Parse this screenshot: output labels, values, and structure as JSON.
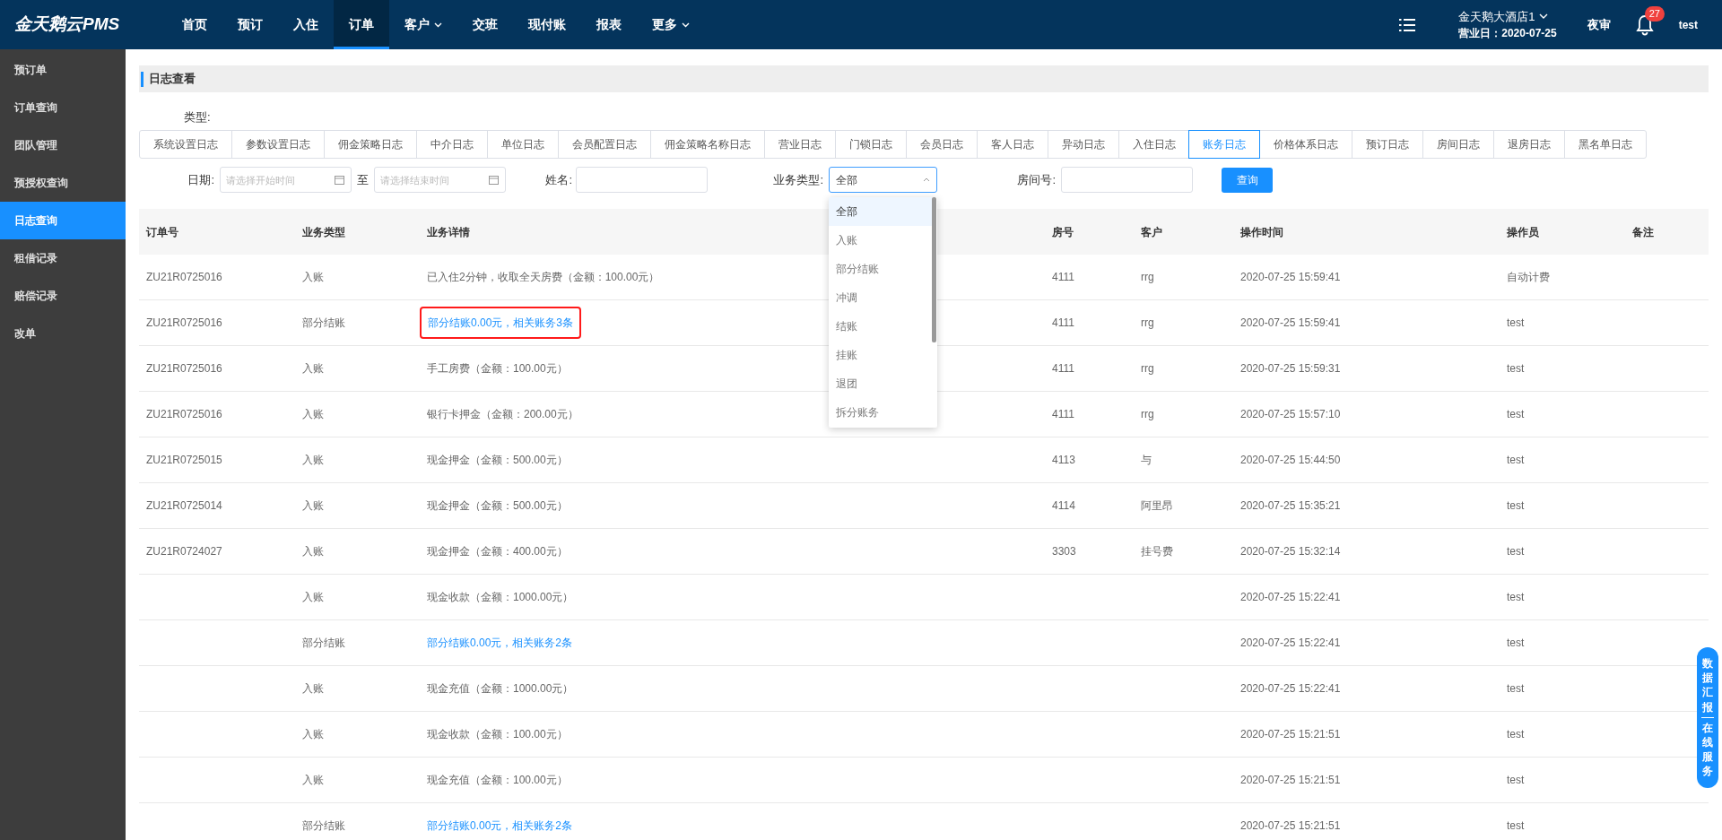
{
  "brand": "金天鹅云PMS",
  "nav": [
    {
      "label": "首页",
      "selected": false,
      "caret": false
    },
    {
      "label": "预订",
      "selected": false,
      "caret": false
    },
    {
      "label": "入住",
      "selected": false,
      "caret": false
    },
    {
      "label": "订单",
      "selected": true,
      "caret": false
    },
    {
      "label": "客户",
      "selected": false,
      "caret": true
    },
    {
      "label": "交班",
      "selected": false,
      "caret": false
    },
    {
      "label": "现付账",
      "selected": false,
      "caret": false
    },
    {
      "label": "报表",
      "selected": false,
      "caret": false
    },
    {
      "label": "更多",
      "selected": false,
      "caret": true
    }
  ],
  "header_right": {
    "hotel": "金天鹅大酒店1",
    "business_day": "营业日：2020-07-25",
    "night_audit": "夜审",
    "notification_count": "27",
    "user": "test"
  },
  "sidebar": {
    "items": [
      {
        "label": "预订单",
        "selected": false
      },
      {
        "label": "订单查询",
        "selected": false
      },
      {
        "label": "团队管理",
        "selected": false
      },
      {
        "label": "预授权查询",
        "selected": false
      },
      {
        "label": "日志查询",
        "selected": true
      },
      {
        "label": "租借记录",
        "selected": false
      },
      {
        "label": "赔偿记录",
        "selected": false
      },
      {
        "label": "改单",
        "selected": false
      }
    ]
  },
  "page_title": "日志查看",
  "type_label": "类型:",
  "log_types": [
    {
      "label": "系统设置日志",
      "selected": false
    },
    {
      "label": "参数设置日志",
      "selected": false
    },
    {
      "label": "佣金策略日志",
      "selected": false
    },
    {
      "label": "中介日志",
      "selected": false
    },
    {
      "label": "单位日志",
      "selected": false
    },
    {
      "label": "会员配置日志",
      "selected": false
    },
    {
      "label": "佣金策略名称日志",
      "selected": false
    },
    {
      "label": "营业日志",
      "selected": false
    },
    {
      "label": "门锁日志",
      "selected": false
    },
    {
      "label": "会员日志",
      "selected": false
    },
    {
      "label": "客人日志",
      "selected": false
    },
    {
      "label": "异动日志",
      "selected": false
    },
    {
      "label": "入住日志",
      "selected": false
    },
    {
      "label": "账务日志",
      "selected": true
    },
    {
      "label": "价格体系日志",
      "selected": false
    },
    {
      "label": "预订日志",
      "selected": false
    },
    {
      "label": "房间日志",
      "selected": false
    },
    {
      "label": "退房日志",
      "selected": false
    },
    {
      "label": "黑名单日志",
      "selected": false
    }
  ],
  "filters": {
    "date_label": "日期:",
    "start_placeholder": "请选择开始时间",
    "to": "至",
    "end_placeholder": "请选择结束时间",
    "name_label": "姓名:",
    "business_type_label": "业务类型:",
    "business_type_value": "全部",
    "room_label": "房间号:",
    "query_button": "查询",
    "business_type_options": [
      {
        "label": "全部",
        "selected": true
      },
      {
        "label": "入账",
        "selected": false
      },
      {
        "label": "部分结账",
        "selected": false
      },
      {
        "label": "冲调",
        "selected": false
      },
      {
        "label": "结账",
        "selected": false
      },
      {
        "label": "挂账",
        "selected": false
      },
      {
        "label": "退团",
        "selected": false
      },
      {
        "label": "拆分账务",
        "selected": false
      }
    ]
  },
  "table": {
    "columns": [
      "订单号",
      "业务类型",
      "业务详情",
      "房号",
      "客户",
      "操作时间",
      "操作员",
      "备注"
    ],
    "rows": [
      {
        "order": "ZU21R0725016",
        "type": "入账",
        "detail": "已入住2分钟，收取全天房费（金额：100.00元）",
        "kind": "text",
        "room": "4111",
        "guest": "rrg",
        "time": "2020-07-25 15:59:41",
        "operator": "自动计费"
      },
      {
        "order": "ZU21R0725016",
        "type": "部分结账",
        "detail": "部分结账0.00元，相关账务3条",
        "kind": "link",
        "highlighted": true,
        "room": "4111",
        "guest": "rrg",
        "time": "2020-07-25 15:59:41",
        "operator": "test"
      },
      {
        "order": "ZU21R0725016",
        "type": "入账",
        "detail": "手工房费（金额：100.00元）",
        "kind": "text",
        "room": "4111",
        "guest": "rrg",
        "time": "2020-07-25 15:59:31",
        "operator": "test"
      },
      {
        "order": "ZU21R0725016",
        "type": "入账",
        "detail": "银行卡押金（金额：200.00元）",
        "kind": "text",
        "room": "4111",
        "guest": "rrg",
        "time": "2020-07-25 15:57:10",
        "operator": "test"
      },
      {
        "order": "ZU21R0725015",
        "type": "入账",
        "detail": "现金押金（金额：500.00元）",
        "kind": "text",
        "room": "4113",
        "guest": "与",
        "time": "2020-07-25 15:44:50",
        "operator": "test"
      },
      {
        "order": "ZU21R0725014",
        "type": "入账",
        "detail": "现金押金（金额：500.00元）",
        "kind": "text",
        "room": "4114",
        "guest": "阿里昂",
        "time": "2020-07-25 15:35:21",
        "operator": "test"
      },
      {
        "order": "ZU21R0724027",
        "type": "入账",
        "detail": "现金押金（金额：400.00元）",
        "kind": "text",
        "room": "3303",
        "guest": "挂号费",
        "time": "2020-07-25 15:32:14",
        "operator": "test"
      },
      {
        "type": "入账",
        "detail": "现金收款（金额：1000.00元）",
        "kind": "text",
        "time": "2020-07-25 15:22:41",
        "operator": "test"
      },
      {
        "type": "部分结账",
        "detail": "部分结账0.00元，相关账务2条",
        "kind": "link",
        "time": "2020-07-25 15:22:41",
        "operator": "test"
      },
      {
        "type": "入账",
        "detail": "现金充值（金额：1000.00元）",
        "kind": "text",
        "time": "2020-07-25 15:22:41",
        "operator": "test"
      },
      {
        "type": "入账",
        "detail": "现金收款（金额：100.00元）",
        "kind": "text",
        "time": "2020-07-25 15:21:51",
        "operator": "test"
      },
      {
        "type": "入账",
        "detail": "现金充值（金额：100.00元）",
        "kind": "text",
        "time": "2020-07-25 15:21:51",
        "operator": "test"
      },
      {
        "type": "部分结账",
        "detail": "部分结账0.00元，相关账务2条",
        "kind": "link",
        "time": "2020-07-25 15:21:51",
        "operator": "test"
      }
    ]
  },
  "service_tab": [
    "数据汇报",
    "在线服务"
  ]
}
